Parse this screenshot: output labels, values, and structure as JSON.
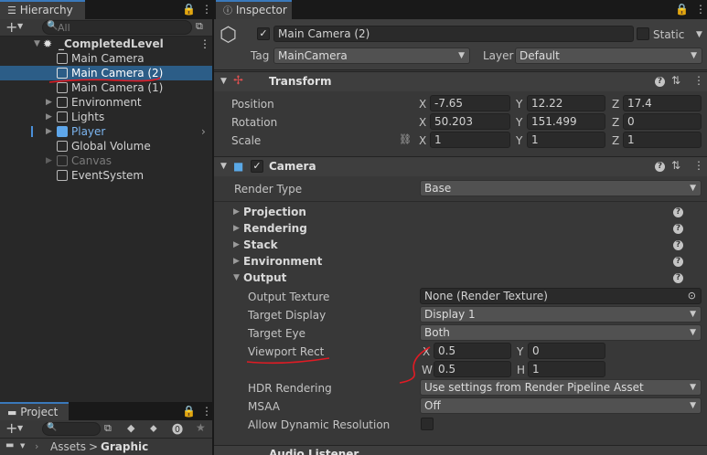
{
  "hierarchy": {
    "tab_label": "Hierarchy",
    "search_placeholder": "All",
    "scene_name": "_CompletedLevel",
    "items": [
      {
        "label": "Main Camera"
      },
      {
        "label": "Main Camera (2)"
      },
      {
        "label": "Main Camera (1)"
      },
      {
        "label": "Environment"
      },
      {
        "label": "Lights"
      },
      {
        "label": "Player"
      },
      {
        "label": "Global Volume"
      },
      {
        "label": "Canvas"
      },
      {
        "label": "EventSystem"
      }
    ]
  },
  "project": {
    "tab_label": "Project",
    "breadcrumb_root": "Assets",
    "breadcrumb_sep": ">",
    "breadcrumb_current": "Graphic"
  },
  "inspector": {
    "tab_label": "Inspector",
    "object_name": "Main Camera (2)",
    "static_label": "Static",
    "tag_label": "Tag",
    "tag_value": "MainCamera",
    "layer_label": "Layer",
    "layer_value": "Default",
    "transform": {
      "title": "Transform",
      "position_label": "Position",
      "rotation_label": "Rotation",
      "scale_label": "Scale",
      "position": {
        "x": "-7.65",
        "y": "12.22",
        "z": "17.4"
      },
      "rotation": {
        "x": "50.203",
        "y": "151.499",
        "z": "0"
      },
      "scale": {
        "x": "1",
        "y": "1",
        "z": "1"
      }
    },
    "camera": {
      "title": "Camera",
      "render_type_label": "Render Type",
      "render_type_value": "Base",
      "sections": [
        "Projection",
        "Rendering",
        "Stack",
        "Environment",
        "Output"
      ],
      "output_texture_label": "Output Texture",
      "output_texture_value": "None (Render Texture)",
      "target_display_label": "Target Display",
      "target_display_value": "Display 1",
      "target_eye_label": "Target Eye",
      "target_eye_value": "Both",
      "viewport_rect_label": "Viewport Rect",
      "viewport": {
        "x": "0.5",
        "y": "0",
        "w": "0.5",
        "h": "1"
      },
      "hdr_label": "HDR Rendering",
      "hdr_value": "Use settings from Render Pipeline Asset",
      "msaa_label": "MSAA",
      "msaa_value": "Off",
      "dynres_label": "Allow Dynamic Resolution"
    },
    "next_component_title": "Audio Listener"
  },
  "axis_labels": {
    "x": "X",
    "y": "Y",
    "z": "Z",
    "w": "W",
    "h": "H"
  },
  "colors": {
    "selection": "#2c5d87",
    "accent_tab": "#3a79bb",
    "annotation_red": "#e01b24",
    "player_blue": "#7cb5f0"
  }
}
